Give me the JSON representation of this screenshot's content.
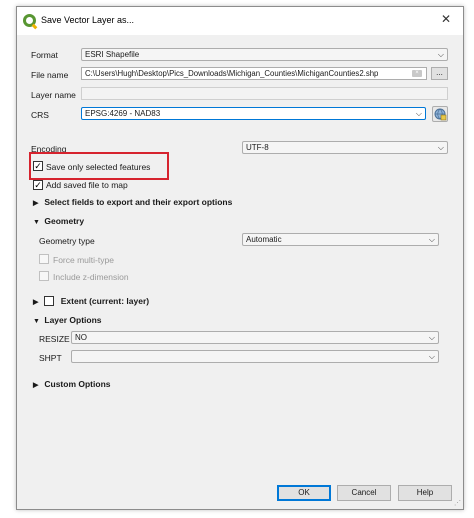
{
  "window": {
    "title": "Save Vector Layer as...",
    "close_glyph": "✕"
  },
  "form": {
    "format_label": "Format",
    "format_value": "ESRI Shapefile",
    "filename_label": "File name",
    "filename_value": "C:\\Users\\Hugh\\Desktop\\Pics_Downloads\\Michigan_Counties\\MichiganCounties2.shp",
    "browse_label": "...",
    "layername_label": "Layer name",
    "layername_value": "",
    "crs_label": "CRS",
    "crs_value": "EPSG:4269 - NAD83",
    "encoding_label": "Encoding",
    "encoding_value": "UTF-8"
  },
  "options": {
    "save_selected_label": "Save only selected features",
    "save_selected_checked": true,
    "add_to_map_label": "Add saved file to map",
    "add_to_map_checked": true
  },
  "sections": {
    "select_fields": "Select fields to export and their export options",
    "geometry": "Geometry",
    "extent": "Extent (current: layer)",
    "layer_options": "Layer Options",
    "custom_options": "Custom Options"
  },
  "geometry": {
    "type_label": "Geometry type",
    "type_value": "Automatic",
    "force_multi_label": "Force multi-type",
    "include_z_label": "Include z-dimension"
  },
  "layer_options": {
    "resize_label": "RESIZE",
    "resize_value": "NO",
    "shpt_label": "SHPT",
    "shpt_value": ""
  },
  "glyphs": {
    "expanded": "▼",
    "collapsed": "▶",
    "check": "✓",
    "dropdown": "⌵"
  },
  "highlight_color": "#d6232e",
  "buttons": {
    "ok": "OK",
    "cancel": "Cancel",
    "help": "Help"
  }
}
